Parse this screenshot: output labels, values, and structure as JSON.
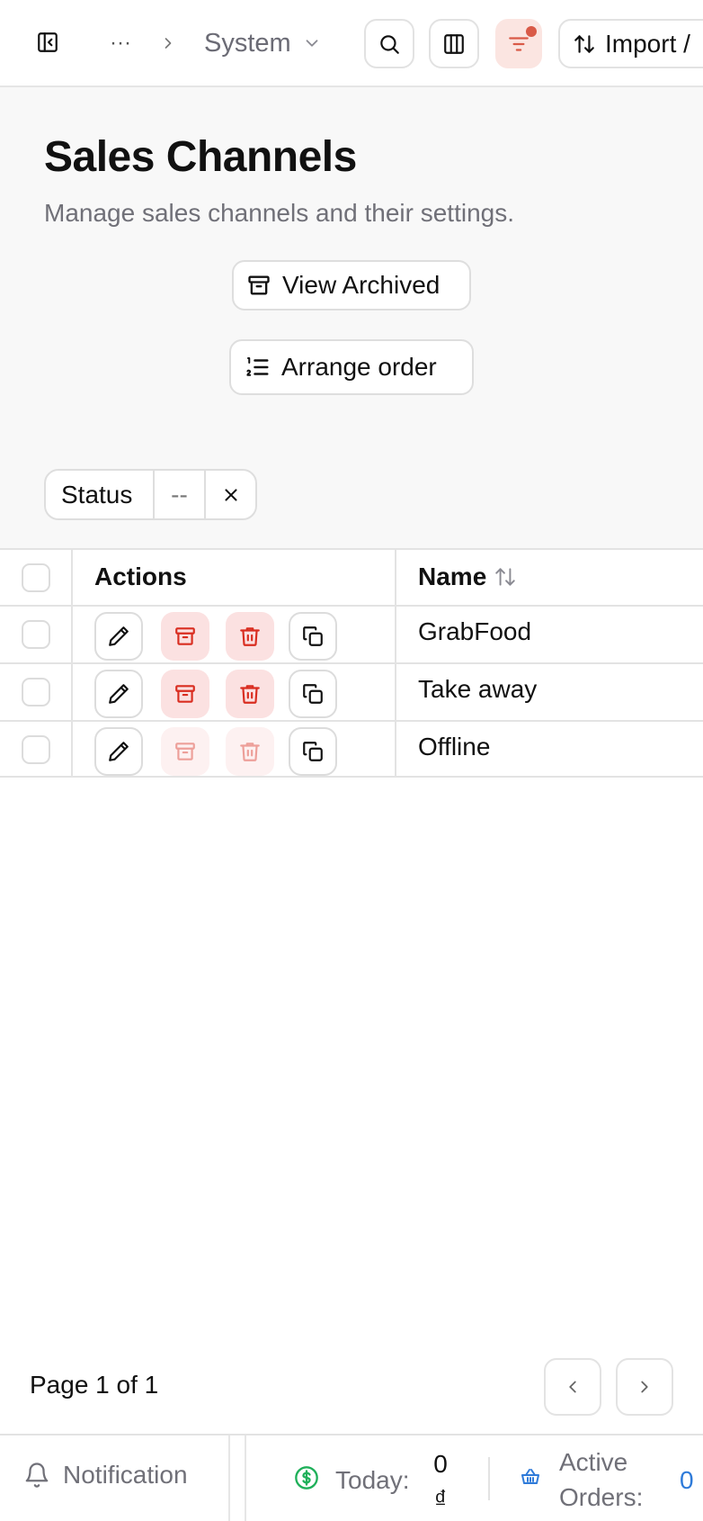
{
  "topbar": {
    "breadcrumb_more": "···",
    "breadcrumb_current": "System",
    "import_label": "Import /"
  },
  "header": {
    "title": "Sales Channels",
    "subtitle": "Manage sales channels and their settings.",
    "view_archived_label": "View Archived",
    "arrange_order_label": "Arrange order"
  },
  "filters": {
    "status_label": "Status",
    "status_value": "--"
  },
  "table": {
    "columns": [
      "Actions",
      "Name"
    ],
    "rows": [
      {
        "name": "GrabFood",
        "archive_enabled": true,
        "delete_enabled": true
      },
      {
        "name": "Take away",
        "archive_enabled": true,
        "delete_enabled": true
      },
      {
        "name": "Offline",
        "archive_enabled": false,
        "delete_enabled": false
      }
    ]
  },
  "pagination": {
    "label": "Page 1 of 1"
  },
  "footer": {
    "notification_label": "Notification",
    "today_label": "Today:",
    "today_value": "0 ₫",
    "active_orders_label": "Active Orders:",
    "active_orders_value": "0"
  },
  "colors": {
    "accent_red": "#d92d20",
    "filter_active_bg": "#fbe5e1",
    "money_green": "#1fb05a",
    "orders_blue": "#2f7bd9"
  },
  "icons": [
    "sidebar-toggle-icon",
    "chevron-right-icon",
    "chevron-down-icon",
    "search-icon",
    "columns-icon",
    "filter-icon",
    "sort-icon",
    "archive-icon",
    "list-ordered-icon",
    "close-icon",
    "pencil-icon",
    "trash-icon",
    "copy-icon",
    "chevron-left-icon",
    "bell-icon",
    "dollar-icon",
    "basket-icon"
  ]
}
